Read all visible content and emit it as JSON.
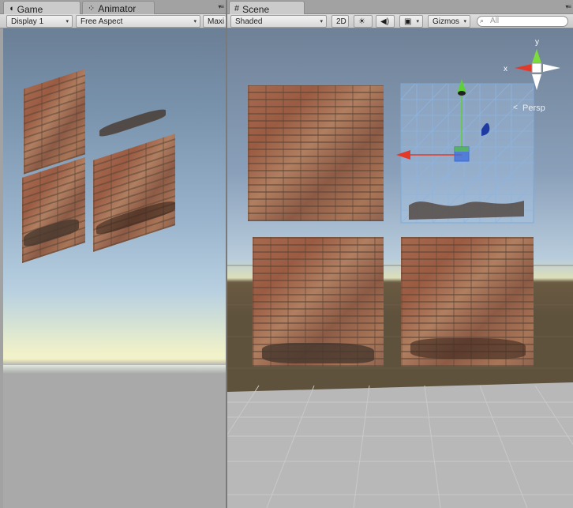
{
  "game_panel": {
    "tabs": [
      {
        "label": "Game",
        "icon": "pacman-icon"
      },
      {
        "label": "Animator",
        "icon": "animator-icon"
      }
    ],
    "toolbar": {
      "display": "Display 1",
      "aspect": "Free Aspect",
      "maximize": "Maxi"
    }
  },
  "scene_panel": {
    "tabs": [
      {
        "label": "Scene",
        "icon": "grid-icon"
      }
    ],
    "toolbar": {
      "shading": "Shaded",
      "mode_2d": "2D",
      "gizmos": "Gizmos",
      "search_placeholder": "All"
    },
    "orientation": {
      "x_label": "x",
      "y_label": "y",
      "projection": "Persp"
    }
  }
}
